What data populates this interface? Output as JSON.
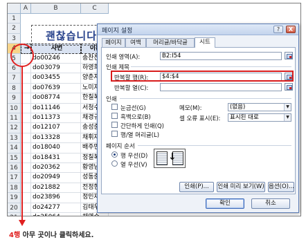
{
  "sheet": {
    "columns": [
      "A",
      "B",
      "C"
    ],
    "rows": [
      "1",
      "2",
      "3",
      "4",
      "5",
      "6",
      "7",
      "8",
      "9",
      "10",
      "11",
      "12",
      "13",
      "14",
      "15",
      "16",
      "17",
      "18",
      "19",
      "20",
      "21"
    ],
    "title": "괜찮습니다",
    "header_arrow": "→",
    "header_id": "사번",
    "header_name": "이름",
    "records": [
      {
        "id": "do00246",
        "name": "송찬진"
      },
      {
        "id": "do03079",
        "name": "하영희"
      },
      {
        "id": "do03455",
        "name": "양춘자"
      },
      {
        "id": "do07639",
        "name": "노미자"
      },
      {
        "id": "do08774",
        "name": "한칠복"
      },
      {
        "id": "do11146",
        "name": "서청수"
      },
      {
        "id": "do11373",
        "name": "채경규"
      },
      {
        "id": "do12107",
        "name": "송성준"
      },
      {
        "id": "do13328",
        "name": "채휘재"
      },
      {
        "id": "do18040",
        "name": "배주민"
      },
      {
        "id": "do18431",
        "name": "정칠복"
      },
      {
        "id": "do20362",
        "name": "황영남"
      },
      {
        "id": "do20949",
        "name": "성동준"
      },
      {
        "id": "do21882",
        "name": "전정현"
      },
      {
        "id": "do23896",
        "name": "정민재"
      },
      {
        "id": "do24277",
        "name": "김태우"
      },
      {
        "id": "do25064",
        "name": "채영수"
      }
    ]
  },
  "dialog": {
    "title": "페이지 설정",
    "help": "?",
    "close": "X",
    "tabs": [
      "페이지",
      "여백",
      "머리글/바닥글",
      "시트"
    ],
    "print_area_label": "인쇄 영역(A):",
    "print_area_value": "B2:I54",
    "print_titles_group": "인쇄 제목",
    "rows_to_repeat_label": "반복할 행(R):",
    "rows_to_repeat_value": "$4:$4",
    "cols_to_repeat_label": "반복할 열(C):",
    "cols_to_repeat_value": "",
    "print_group": "인쇄",
    "gridlines": "눈금선(G)",
    "black_white": "흑백으로(B)",
    "draft": "간단하게 인쇄(Q)",
    "row_col_headings": "행/열 머리글(L)",
    "comments_label": "메모(M):",
    "comments_value": "(없음)",
    "errors_label": "셀 오류 표시(E):",
    "errors_value": "표시된 대로",
    "page_order_group": "페이지 순서",
    "down_then_over": "행 우선(D)",
    "over_then_down": "열 우선(V)",
    "print_btn": "인쇄(P)...",
    "preview_btn": "인쇄 미리 보기(W)",
    "options_btn": "옵션(O)...",
    "ok_btn": "확인",
    "cancel_btn": "취소"
  },
  "annotation": {
    "caption_num": "4행",
    "caption_rest": " 아무 곳이나 클릭하세요."
  },
  "colors": {
    "highlight": "#e02020",
    "header_fill": "#d9e2f1",
    "title_text": "#243f8a"
  }
}
